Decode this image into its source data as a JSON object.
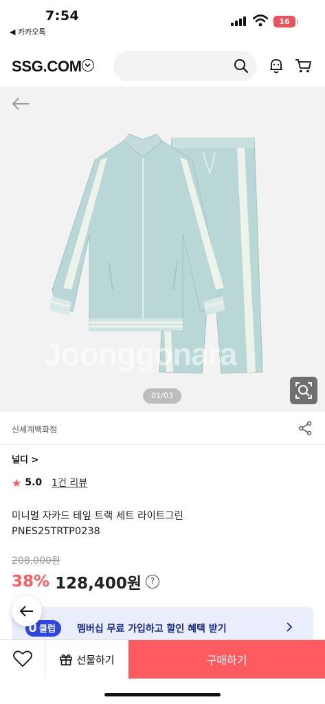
{
  "status_bar": {
    "time": "7:54",
    "back_app": "◀ 카카오톡",
    "battery": "16"
  },
  "header": {
    "logo": "SSG.COM",
    "search_placeholder": ""
  },
  "gallery": {
    "watermark": "Joonggonara",
    "page_indicator": "01/03"
  },
  "seller": {
    "name": "신세계백화점"
  },
  "product": {
    "brand": "널디 >",
    "rating": "5.0",
    "review_link": "1건 리뷰",
    "title_line1": "미니멀 자카드 테잎 트랙 세트 라이트그린",
    "title_line2": "PNES25TRTP0238",
    "original_price": "208,000원",
    "discount": "38%",
    "sale_price": "128,400원",
    "info_symbol": "?"
  },
  "membership_banner": {
    "badge_u": "U",
    "badge_text": "클럽",
    "text": "멤버십 무료 가입하고 할인 혜택 받기"
  },
  "bottom_bar": {
    "gift_label": "선물하기",
    "buy_label": "구매하기"
  },
  "colors": {
    "accent": "#ff5a5f",
    "uclub_blue": "#2f46e0",
    "banner_bg": "#e9edfc",
    "product_mint": "#b9d7d6"
  },
  "icons": [
    "signal-icon",
    "wifi-icon",
    "chevron-down-icon",
    "search-icon",
    "bell-icon",
    "cart-icon",
    "back-arrow-icon",
    "lens-icon",
    "share-icon",
    "star-icon",
    "info-icon",
    "chevron-right-icon",
    "heart-icon",
    "gift-icon"
  ]
}
